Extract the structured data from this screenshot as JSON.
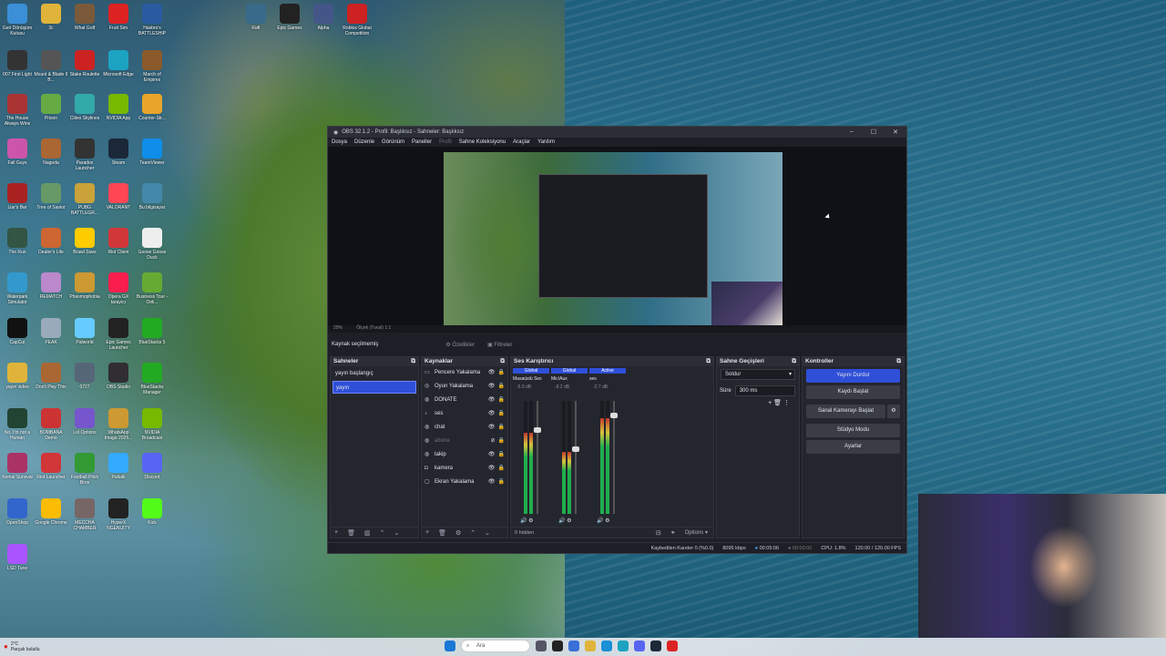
{
  "desktop": {
    "icons": [
      {
        "label": "Geri Dönüşüm Kutusu",
        "color": "#3b8fd6"
      },
      {
        "label": "3c",
        "color": "#e0b43a"
      },
      {
        "label": "What Golf",
        "color": "#7a5a3a"
      },
      {
        "label": "Fruit Sim",
        "color": "#d22"
      },
      {
        "label": "Hasbro's BATTLESHIP",
        "color": "#2a5aa0"
      },
      {
        "label": "007 First Light",
        "color": "#333"
      },
      {
        "label": "Mount & Blade II B...",
        "color": "#555"
      },
      {
        "label": "Stake Roulette",
        "color": "#c22"
      },
      {
        "label": "Microsoft Edge",
        "color": "#1ca3c2"
      },
      {
        "label": "March of Empires",
        "color": "#8a5a2a"
      },
      {
        "label": "The House Always Wins",
        "color": "#a33"
      },
      {
        "label": "Prison",
        "color": "#6a4"
      },
      {
        "label": "Cities Skylines",
        "color": "#3aa"
      },
      {
        "label": "NVIDIA App",
        "color": "#76b900"
      },
      {
        "label": "Counter-Str...",
        "color": "#e9a52b"
      },
      {
        "label": "Fall Guys",
        "color": "#c5a"
      },
      {
        "label": "Nagoda",
        "color": "#a63"
      },
      {
        "label": "Paradox Launcher",
        "color": "#333"
      },
      {
        "label": "Steam",
        "color": "#1b2838"
      },
      {
        "label": "TeamViewer",
        "color": "#0e8ee9"
      },
      {
        "label": "Liar's Bar",
        "color": "#a22"
      },
      {
        "label": "Tree of Savior",
        "color": "#696"
      },
      {
        "label": "PUBG BATTLEGR...",
        "color": "#c9a23a"
      },
      {
        "label": "VALORANT",
        "color": "#ff4655"
      },
      {
        "label": "Bu bilgisayar",
        "color": "#48a"
      },
      {
        "label": "The Run",
        "color": "#354"
      },
      {
        "label": "Dealer's Life",
        "color": "#c63"
      },
      {
        "label": "Brawl Stars",
        "color": "#fc0"
      },
      {
        "label": "Riot Client",
        "color": "#d13639"
      },
      {
        "label": "Goose Goose Duck",
        "color": "#eee"
      },
      {
        "label": "Waterpark Simulator",
        "color": "#39c"
      },
      {
        "label": "REMATCH",
        "color": "#b8c"
      },
      {
        "label": "Phasmophobia",
        "color": "#c93"
      },
      {
        "label": "Opera GX tarayıcı",
        "color": "#fa1e4e"
      },
      {
        "label": "Business Tour - Onli...",
        "color": "#6a3"
      },
      {
        "label": "CapCut",
        "color": "#111"
      },
      {
        "label": "PEAK",
        "color": "#9ab"
      },
      {
        "label": "Palworld",
        "color": "#6cf"
      },
      {
        "label": "Epic Games Launcher",
        "color": "#222"
      },
      {
        "label": "BlueStacks 5",
        "color": "#2a2"
      },
      {
        "label": "yayın video",
        "color": "#e0b43a"
      },
      {
        "label": "Don't Play This",
        "color": "#a63"
      },
      {
        "label": "0727",
        "color": "#567"
      },
      {
        "label": "OBS Studio",
        "color": "#302e31"
      },
      {
        "label": "BlueStacks Manager",
        "color": "#2a2"
      },
      {
        "label": "No, I'm not a Human",
        "color": "#243"
      },
      {
        "label": "BOMBANA Demo",
        "color": "#c33"
      },
      {
        "label": "Lol Options",
        "color": "#75c"
      },
      {
        "label": "WhatsApp Image 2025...",
        "color": "#c93"
      },
      {
        "label": "NVIDIA Broadcast",
        "color": "#76b900"
      },
      {
        "label": "Kemal Survival",
        "color": "#a36"
      },
      {
        "label": "Riot Launcher",
        "color": "#d13639"
      },
      {
        "label": "Football Pitch Bros",
        "color": "#393"
      },
      {
        "label": "Paltalk",
        "color": "#3af"
      },
      {
        "label": "Discord",
        "color": "#5865f2"
      },
      {
        "label": "OpenShop",
        "color": "#36c"
      },
      {
        "label": "Google Chrome",
        "color": "#fbbc05"
      },
      {
        "label": "MECCHA CHAMBER",
        "color": "#766"
      },
      {
        "label": "HyperX NGENUITY",
        "color": "#222"
      },
      {
        "label": "Kick",
        "color": "#53fc18"
      },
      {
        "label": "LSD Tune",
        "color": "#a5f"
      }
    ],
    "top_icons": [
      {
        "label": "Raft",
        "color": "#3a6a8a"
      },
      {
        "label": "Epic Games",
        "color": "#222"
      },
      {
        "label": "Alpha",
        "color": "#458"
      },
      {
        "label": "Roblox Global Competition",
        "color": "#c22"
      }
    ]
  },
  "obs": {
    "title": "OBS 32.1.2 - Profil: Başlıksız - Sahneler: Başlıksız",
    "menu": [
      "Dosya",
      "Düzenle",
      "Görünüm",
      "Paneller",
      "Profil",
      "Sahne Koleksiyonu",
      "Araçlar",
      "Yardım"
    ],
    "zoom_label": "29%",
    "zoom_select": "Ölçek (Tuval) 1:1",
    "source_bar": {
      "status": "Kaynak seçilmemiş",
      "properties": "Özellikler",
      "filters": "Filtreler"
    },
    "scenes": {
      "title": "Sahneler",
      "items": [
        "yayın başlangıç",
        "yayın"
      ],
      "selected_index": 1
    },
    "sources": {
      "title": "Kaynaklar",
      "items": [
        {
          "icon": "window-icon",
          "name": "Pencere Yakalama",
          "visible": true
        },
        {
          "icon": "gamepad-icon",
          "name": "Oyun Yakalama",
          "visible": true
        },
        {
          "icon": "globe-icon",
          "name": "DONATE",
          "visible": true
        },
        {
          "icon": "mic-icon",
          "name": "ses",
          "visible": true
        },
        {
          "icon": "globe-icon",
          "name": "chat",
          "visible": true
        },
        {
          "icon": "globe-icon",
          "name": "abone",
          "visible": false
        },
        {
          "icon": "globe-icon",
          "name": "takip",
          "visible": true
        },
        {
          "icon": "camera-icon",
          "name": "kamera",
          "visible": true
        },
        {
          "icon": "monitor-icon",
          "name": "Ekran Yakalama",
          "visible": true
        }
      ]
    },
    "mixer": {
      "title": "Ses Karıştırıcı",
      "channels": [
        {
          "tag": "Global",
          "name": "Masaüstü Ses",
          "db": "-5.9 dB",
          "level": 0.72
        },
        {
          "tag": "Global",
          "name": "Mic/Aux",
          "db": "-8.2 dB",
          "level": 0.55
        },
        {
          "tag": "Active",
          "name": "ses",
          "db": "-2.7 dB",
          "level": 0.85
        }
      ],
      "hidden": "0 hidden",
      "options": "Options"
    },
    "transitions": {
      "title": "Sahne Geçişleri",
      "type": "Soldur",
      "duration_label": "Süre",
      "duration": "300 ms"
    },
    "controls": {
      "title": "Kontroller",
      "buttons": [
        "Yayını Durdur",
        "Kaydı Başlat",
        "Sanal Kamerayı Başlat",
        "Stüdyo Modu",
        "Ayarlar"
      ]
    },
    "status": {
      "dropped": "Kaybedilen Kareler 0 (%0.0)",
      "bitrate": "8095 kbps",
      "stream_time": "00:05:06",
      "rec_time": "00:00:00",
      "cpu": "CPU: 1.8%",
      "fps": "120.00 / 120.00 FPS"
    }
  },
  "taskbar": {
    "weather_temp": "2°C",
    "weather_text": "Parçalı bulutlu",
    "search_placeholder": "Ara"
  }
}
